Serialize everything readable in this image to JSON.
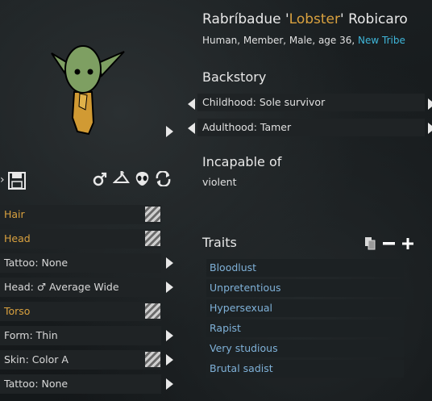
{
  "header": {
    "name_first": "Rabríbadue '",
    "name_nick": "Lobster",
    "name_last": "' Robicaro",
    "subline": "Human, Member, Male, age 36, ",
    "faction": "New Tribe"
  },
  "backstory": {
    "title": "Backstory",
    "childhood": "Childhood: Sole survivor",
    "adulthood": "Adulthood: Tamer"
  },
  "incapable": {
    "title": "Incapable of",
    "value": "violent"
  },
  "traits": {
    "title": "Traits",
    "items": [
      "Bloodlust",
      "Unpretentious",
      "Hypersexual",
      "Rapist",
      "Very studious",
      "Brutal sadist"
    ]
  },
  "appearance": {
    "rows": [
      "Hair",
      "Head",
      "Tattoo: None",
      "Head: ♂ Average Wide",
      "Torso",
      "Form: Thin",
      "Skin: Color A",
      "Tattoo: None"
    ]
  },
  "icons": {
    "save": "save-icon",
    "gender": "male-symbol-icon",
    "apparel": "clothes-hanger-icon",
    "alien": "alien-head-icon",
    "randomize": "cycle-arrows-icon"
  },
  "colors": {
    "accent_orange": "#d9a13f",
    "faction_blue": "#3fb6d9",
    "trait_blue": "#7fb1d8",
    "skin_green": "#7e9f62"
  }
}
